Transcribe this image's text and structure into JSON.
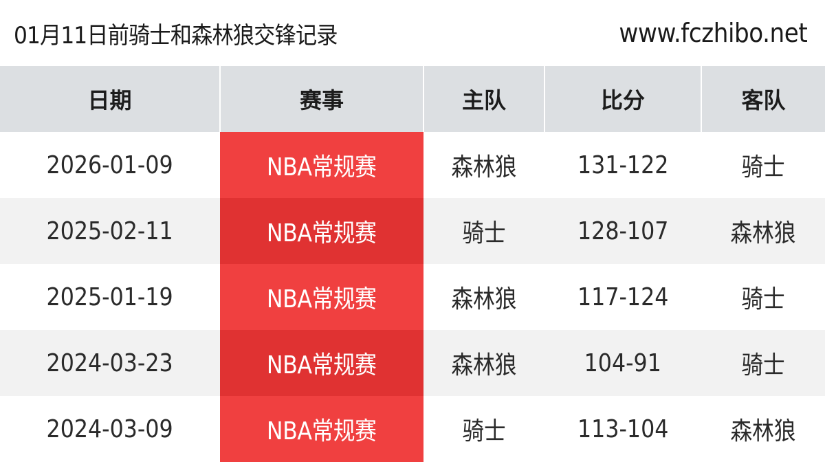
{
  "header": {
    "title": "01月11日前骑士和森林狼交锋记录",
    "site": "www.fczhibo.net"
  },
  "table": {
    "columns": [
      "日期",
      "赛事",
      "主队",
      "比分",
      "客队"
    ],
    "rows": [
      {
        "date": "2026-01-09",
        "event": "NBA常规赛",
        "home": "森林狼",
        "score": "131-122",
        "away": "骑士"
      },
      {
        "date": "2025-02-11",
        "event": "NBA常规赛",
        "home": "骑士",
        "score": "128-107",
        "away": "森林狼"
      },
      {
        "date": "2025-01-19",
        "event": "NBA常规赛",
        "home": "森林狼",
        "score": "117-124",
        "away": "骑士"
      },
      {
        "date": "2024-03-23",
        "event": "NBA常规赛",
        "home": "森林狼",
        "score": "104-91",
        "away": "骑士"
      },
      {
        "date": "2024-03-09",
        "event": "NBA常规赛",
        "home": "骑士",
        "score": "113-104",
        "away": "森林狼"
      }
    ]
  },
  "colors": {
    "header_bg": "#dcdfe2",
    "event_bg": "#f04040",
    "row_alt_bg": "#f2f2f2"
  }
}
